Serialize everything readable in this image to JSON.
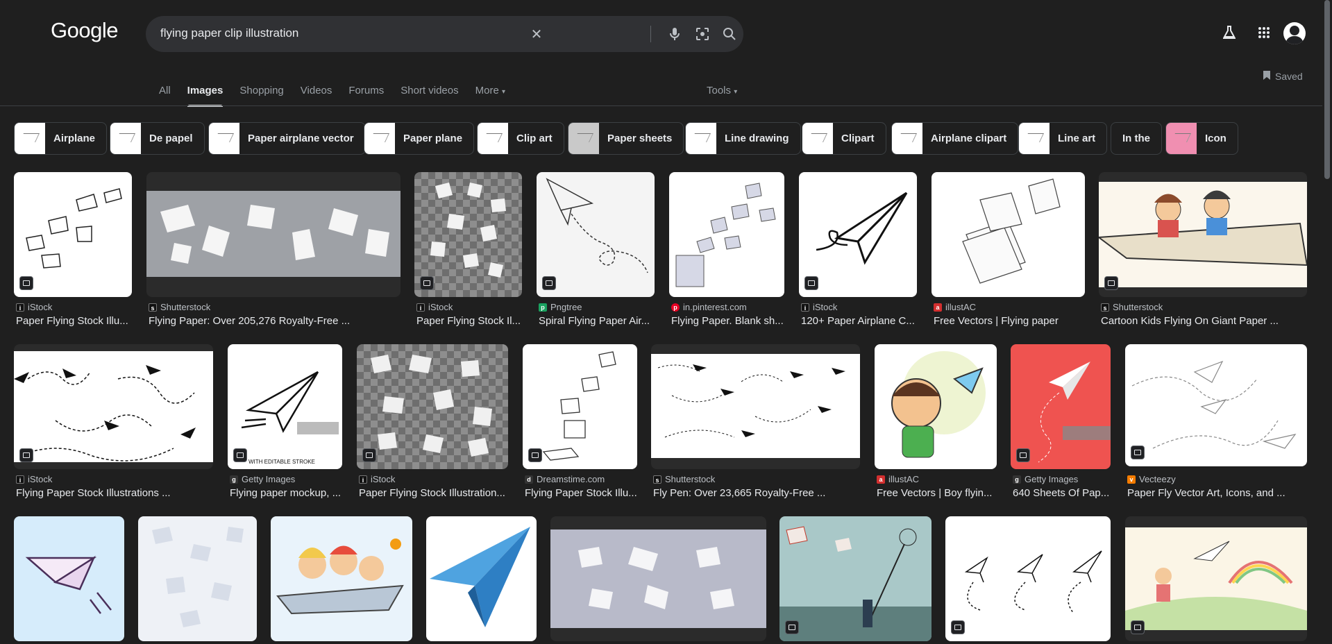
{
  "header": {
    "logo": "Google",
    "search_query": "flying paper clip illustration"
  },
  "tabs": [
    "All",
    "Images",
    "Shopping",
    "Videos",
    "Forums",
    "Short videos",
    "More"
  ],
  "tools_label": "Tools",
  "saved_label": "Saved",
  "chips": [
    "Airplane",
    "De papel",
    "Paper airplane vector",
    "Paper plane",
    "Clip art",
    "Paper sheets",
    "Line drawing",
    "Clipart",
    "Airplane clipart",
    "Line art",
    "In the",
    "Icon"
  ],
  "results": [
    {
      "source": "iStock",
      "title": "Paper Flying Stock Illu..."
    },
    {
      "source": "Shutterstock",
      "title": "Flying Paper: Over 205,276 Royalty-Free ..."
    },
    {
      "source": "iStock",
      "title": "Paper Flying Stock Il..."
    },
    {
      "source": "Pngtree",
      "title": "Spiral Flying Paper Air..."
    },
    {
      "source": "in.pinterest.com",
      "title": "Flying Paper. Blank sh..."
    },
    {
      "source": "iStock",
      "title": "120+ Paper Airplane C..."
    },
    {
      "source": "illustAC",
      "title": "Free Vectors | Flying paper"
    },
    {
      "source": "Shutterstock",
      "title": "Cartoon Kids Flying On Giant Paper ..."
    },
    {
      "source": "iStock",
      "title": "Flying Paper Stock Illustrations ..."
    },
    {
      "source": "Getty Images",
      "title": "Flying paper mockup, ..."
    },
    {
      "source": "iStock",
      "title": "Paper Flying Stock Illustration..."
    },
    {
      "source": "Dreamstime.com",
      "title": "Flying Paper Stock Illu..."
    },
    {
      "source": "Shutterstock",
      "title": "Fly Pen: Over 23,665 Royalty-Free ..."
    },
    {
      "source": "illustAC",
      "title": "Free Vectors | Boy flyin..."
    },
    {
      "source": "Getty Images",
      "title": "640 Sheets Of Pap..."
    },
    {
      "source": "Vecteezy",
      "title": "Paper Fly Vector Art, Icons, and ..."
    }
  ],
  "colors": {
    "background": "#1f1f1f",
    "searchbox": "#303134",
    "text_primary": "#e8eaed",
    "text_secondary": "#9aa0a6"
  }
}
